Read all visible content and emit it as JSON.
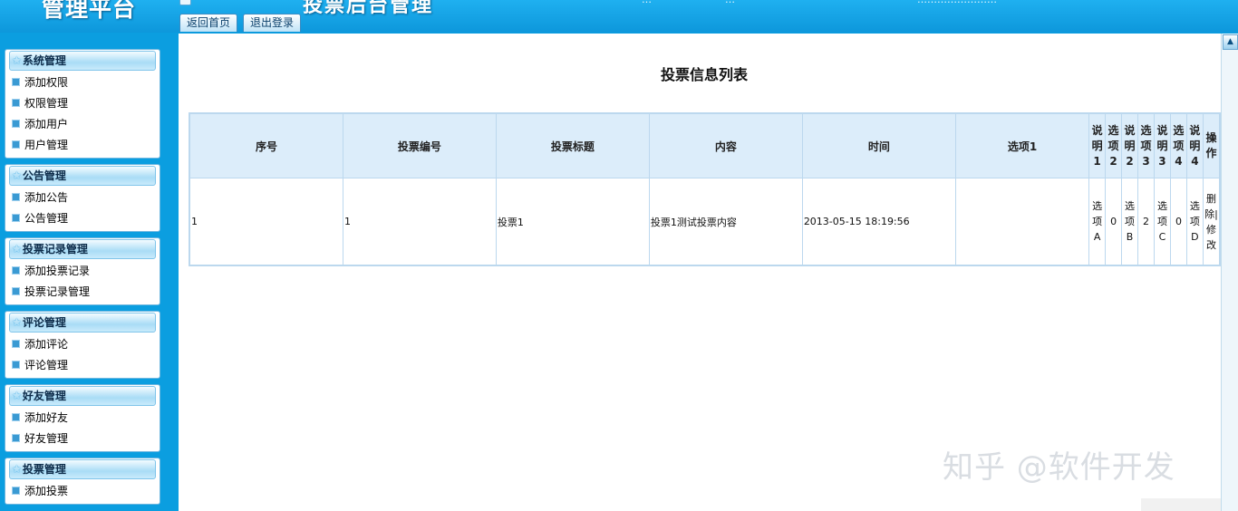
{
  "header": {
    "logo": "管理平台",
    "system_title": "投票后台管理",
    "top_texts": [
      "…",
      "…",
      "……………………"
    ],
    "tabs": [
      "返回首页",
      "退出登录"
    ]
  },
  "sidebar": {
    "groups": [
      {
        "title": "系统管理",
        "items": [
          "添加权限",
          "权限管理",
          "添加用户",
          "用户管理"
        ]
      },
      {
        "title": "公告管理",
        "items": [
          "添加公告",
          "公告管理"
        ]
      },
      {
        "title": "投票记录管理",
        "items": [
          "添加投票记录",
          "投票记录管理"
        ]
      },
      {
        "title": "评论管理",
        "items": [
          "添加评论",
          "评论管理"
        ]
      },
      {
        "title": "好友管理",
        "items": [
          "添加好友",
          "好友管理"
        ]
      },
      {
        "title": "投票管理",
        "items": [
          "添加投票"
        ]
      }
    ]
  },
  "main": {
    "title": "投票信息列表",
    "columns": [
      "序号",
      "投票编号",
      "投票标题",
      "内容",
      "时间",
      "选项1",
      "说明1",
      "选项2",
      "说明2",
      "选项3",
      "说明3",
      "选项4",
      "说明4",
      "操作"
    ],
    "rows": [
      {
        "cells": [
          "1",
          "1",
          "投票1",
          "投票1测试投票内容",
          "2013-05-15 18:19:56",
          "",
          "选项A",
          "0",
          "选项B",
          "2",
          "选项C",
          "0",
          "选项D"
        ],
        "ops": {
          "delete": "删除",
          "sep": "|",
          "edit": "修改"
        }
      }
    ]
  },
  "watermark": "知乎 @软件开发",
  "colors": {
    "frame_blue": "#0b9ee0",
    "header_cell": "#dcedfa",
    "border": "#bcd8ee"
  }
}
